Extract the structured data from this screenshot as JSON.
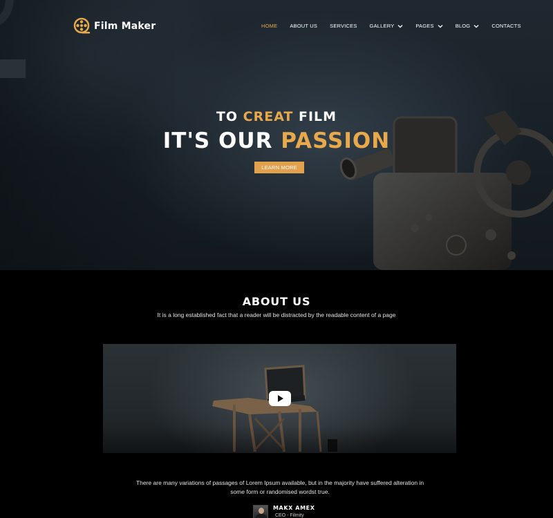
{
  "brand": {
    "name": "Film Maker",
    "accent": "#e8a94c"
  },
  "nav": {
    "items": [
      {
        "label": "HOME",
        "active": true,
        "dropdown": false
      },
      {
        "label": "ABOUT US",
        "active": false,
        "dropdown": false
      },
      {
        "label": "SERVICES",
        "active": false,
        "dropdown": false
      },
      {
        "label": "GALLERY",
        "active": false,
        "dropdown": true
      },
      {
        "label": "PAGES",
        "active": false,
        "dropdown": true
      },
      {
        "label": "BLOG",
        "active": false,
        "dropdown": true
      },
      {
        "label": "CONTACTS",
        "active": false,
        "dropdown": false
      }
    ]
  },
  "hero": {
    "line1_pre": "TO ",
    "line1_accent": "CREAT",
    "line1_post": " FILM",
    "line2_pre": "IT'S OUR ",
    "line2_accent": "PASSION",
    "cta_label": "LEARN MORE"
  },
  "about": {
    "title": "ABOUT US",
    "subtitle": "It is a long established fact that a reader will be distracted by the readable content of a page",
    "paragraph": "There are many variations of passages of Lorem Ipsum available, but in the majority have suffered alteration in some form or randomised wordst true.",
    "author_name": "MAKX AMEX",
    "author_role": "CEO - Filmity"
  },
  "icons": {
    "logo": "film-reel-icon",
    "video_play": "play-icon",
    "dropdown": "chevron-down-icon"
  }
}
